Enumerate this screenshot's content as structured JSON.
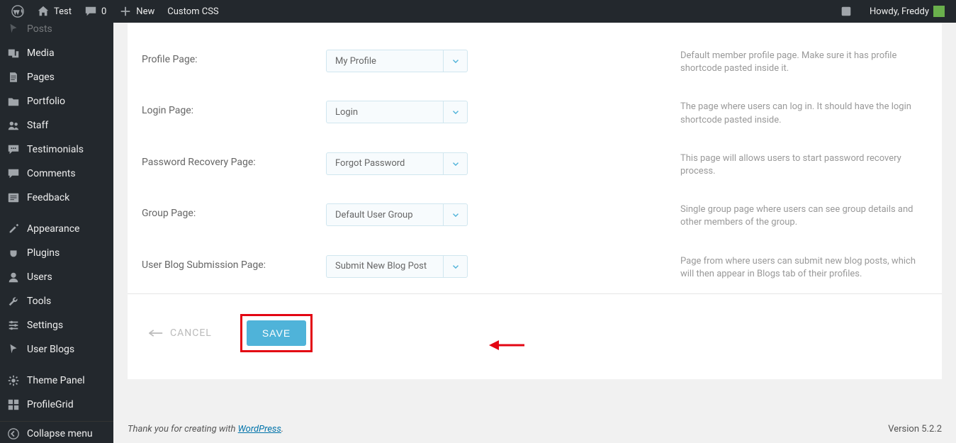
{
  "adminbar": {
    "site_name": "Test",
    "comments_count": "0",
    "new_label": "New",
    "custom_css": "Custom CSS",
    "howdy": "Howdy, Freddy"
  },
  "sidebar": {
    "items": [
      {
        "label": "Posts",
        "icon": "pin"
      },
      {
        "label": "Media",
        "icon": "media"
      },
      {
        "label": "Pages",
        "icon": "page"
      },
      {
        "label": "Portfolio",
        "icon": "folder"
      },
      {
        "label": "Staff",
        "icon": "group"
      },
      {
        "label": "Testimonials",
        "icon": "chat"
      },
      {
        "label": "Comments",
        "icon": "comment"
      },
      {
        "label": "Feedback",
        "icon": "feedback"
      }
    ],
    "items2": [
      {
        "label": "Appearance",
        "icon": "brush"
      },
      {
        "label": "Plugins",
        "icon": "plug"
      },
      {
        "label": "Users",
        "icon": "user"
      },
      {
        "label": "Tools",
        "icon": "wrench"
      },
      {
        "label": "Settings",
        "icon": "sliders"
      },
      {
        "label": "User Blogs",
        "icon": "pin"
      }
    ],
    "items3": [
      {
        "label": "Theme Panel",
        "icon": "gear"
      },
      {
        "label": "ProfileGrid",
        "icon": "grid"
      }
    ],
    "collapse": "Collapse menu"
  },
  "form": {
    "rows": [
      {
        "label": "Profile Page:",
        "value": "My Profile",
        "help": "Default member profile page. Make sure it has profile shortcode pasted inside it."
      },
      {
        "label": "Login Page:",
        "value": "Login",
        "help": "The page where users can log in. It should have the login shortcode pasted inside."
      },
      {
        "label": "Password Recovery Page:",
        "value": "Forgot Password",
        "help": "This page will allows users to start password recovery process."
      },
      {
        "label": "Group Page:",
        "value": "Default User Group",
        "help": "Single group page where users can see group details and other members of the group."
      },
      {
        "label": "User Blog Submission Page:",
        "value": "Submit New Blog Post",
        "help": "Page from where users can submit new blog posts, which will then appear in Blogs tab of their profiles."
      }
    ],
    "cancel": "CANCEL",
    "save": "SAVE"
  },
  "footer": {
    "thanks_prefix": "Thank you for creating with ",
    "wp": "WordPress",
    "version": "Version 5.2.2"
  }
}
